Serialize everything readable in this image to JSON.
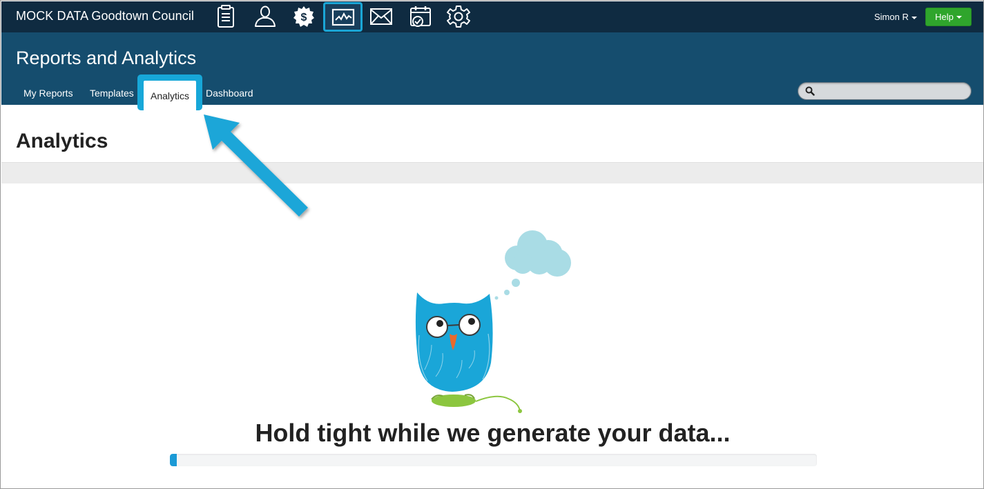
{
  "topbar": {
    "org_name": "MOCK DATA Goodtown Council",
    "icons": [
      "notepad-icon",
      "person-icon",
      "dollar-badge-icon",
      "analytics-chart-icon",
      "mail-icon",
      "calendar-check-icon",
      "gear-icon"
    ],
    "active_icon": "analytics-chart-icon",
    "user_label": "Simon R",
    "help_label": "Help"
  },
  "section": {
    "title": "Reports and Analytics",
    "tabs": [
      {
        "label": "My Reports"
      },
      {
        "label": "Templates"
      },
      {
        "label": "Analytics",
        "active": true
      },
      {
        "label": "Dashboard"
      }
    ],
    "search_placeholder": ""
  },
  "main": {
    "page_title": "Analytics",
    "loading_message": "Hold tight while we generate your data...",
    "progress_fraction": 0.011
  },
  "colors": {
    "topbar": "#0f2b41",
    "header": "#154d6e",
    "highlight": "#17a7d8",
    "help_button": "#2fa52c",
    "owl": "#1aa6d8"
  }
}
